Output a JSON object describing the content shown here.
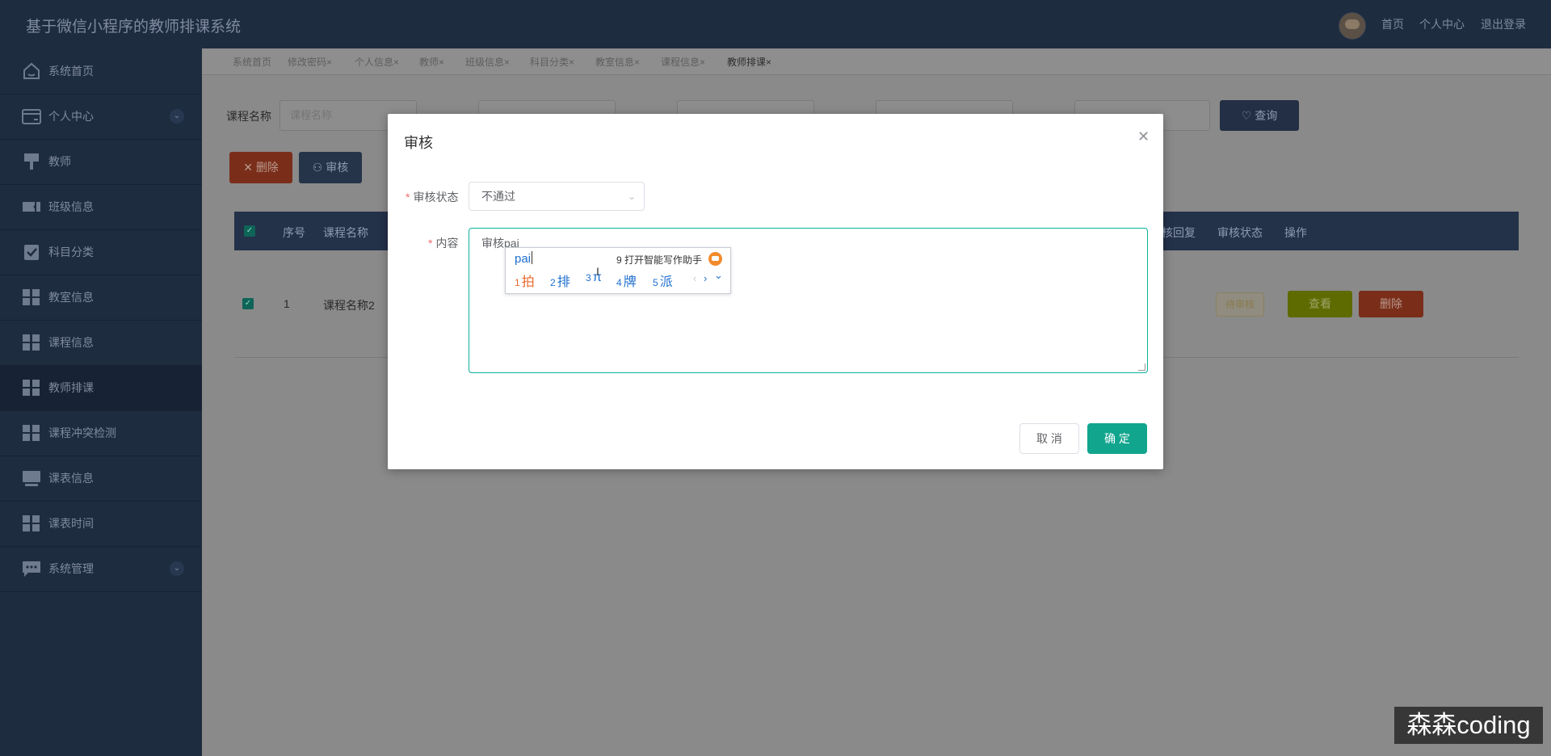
{
  "header": {
    "title": "基于微信小程序的教师排课系统",
    "links": {
      "home": "首页",
      "profile": "个人中心",
      "logout": "退出登录"
    }
  },
  "sidebar": {
    "items": [
      {
        "label": "系统首页",
        "icon": "home-icon"
      },
      {
        "label": "个人中心",
        "icon": "card-icon",
        "expandable": true
      },
      {
        "label": "教师",
        "icon": "easel-icon"
      },
      {
        "label": "班级信息",
        "icon": "ticket-icon"
      },
      {
        "label": "科目分类",
        "icon": "clipboard-check-icon"
      },
      {
        "label": "教室信息",
        "icon": "grid-icon"
      },
      {
        "label": "课程信息",
        "icon": "grid-icon"
      },
      {
        "label": "教师排课",
        "icon": "grid-icon",
        "active": true
      },
      {
        "label": "课程冲突检测",
        "icon": "grid-icon"
      },
      {
        "label": "课表信息",
        "icon": "monitor-icon"
      },
      {
        "label": "课表时间",
        "icon": "grid-icon"
      },
      {
        "label": "系统管理",
        "icon": "chat-icon",
        "expandable": true
      }
    ]
  },
  "tabs": [
    "系统首页",
    "修改密码",
    "个人信息",
    "教师",
    "班级信息",
    "科目分类",
    "教室信息",
    "课程信息",
    "教师排课"
  ],
  "tab_close_glyph": "×",
  "search": {
    "course_label": "课程名称",
    "course_placeholder": "课程名称",
    "query_label": "查询"
  },
  "actions": {
    "delete": "删除",
    "audit": "审核"
  },
  "table": {
    "headers": {
      "index": "序号",
      "course": "课程名称",
      "reply": "核回复",
      "status": "审核状态",
      "op": "操作"
    },
    "rows": [
      {
        "index": "1",
        "course": "课程名称2",
        "status": "待审核",
        "view": "查看",
        "delete": "删除"
      }
    ]
  },
  "dialog": {
    "title": "审核",
    "status_label": "审核状态",
    "status_value": "不通过",
    "content_label": "内容",
    "content_value": "审核pai",
    "cancel": "取 消",
    "confirm": "确 定"
  },
  "ime": {
    "composition": "pai",
    "assist": "9 打开智能写作助手",
    "candidates": [
      {
        "num": "1",
        "text": "拍"
      },
      {
        "num": "2",
        "text": "排"
      },
      {
        "num": "3",
        "text": "π"
      },
      {
        "num": "4",
        "text": "牌"
      },
      {
        "num": "5",
        "text": "派"
      }
    ],
    "prev": "‹",
    "next": "›",
    "more": "⌄"
  },
  "watermark": "森森coding",
  "colors": {
    "accent": "#12a58e",
    "danger": "#7a2e1a",
    "sidebar": "#1e2c40",
    "ime_first": "#e8672b",
    "ime_other": "#1f6fcf"
  }
}
